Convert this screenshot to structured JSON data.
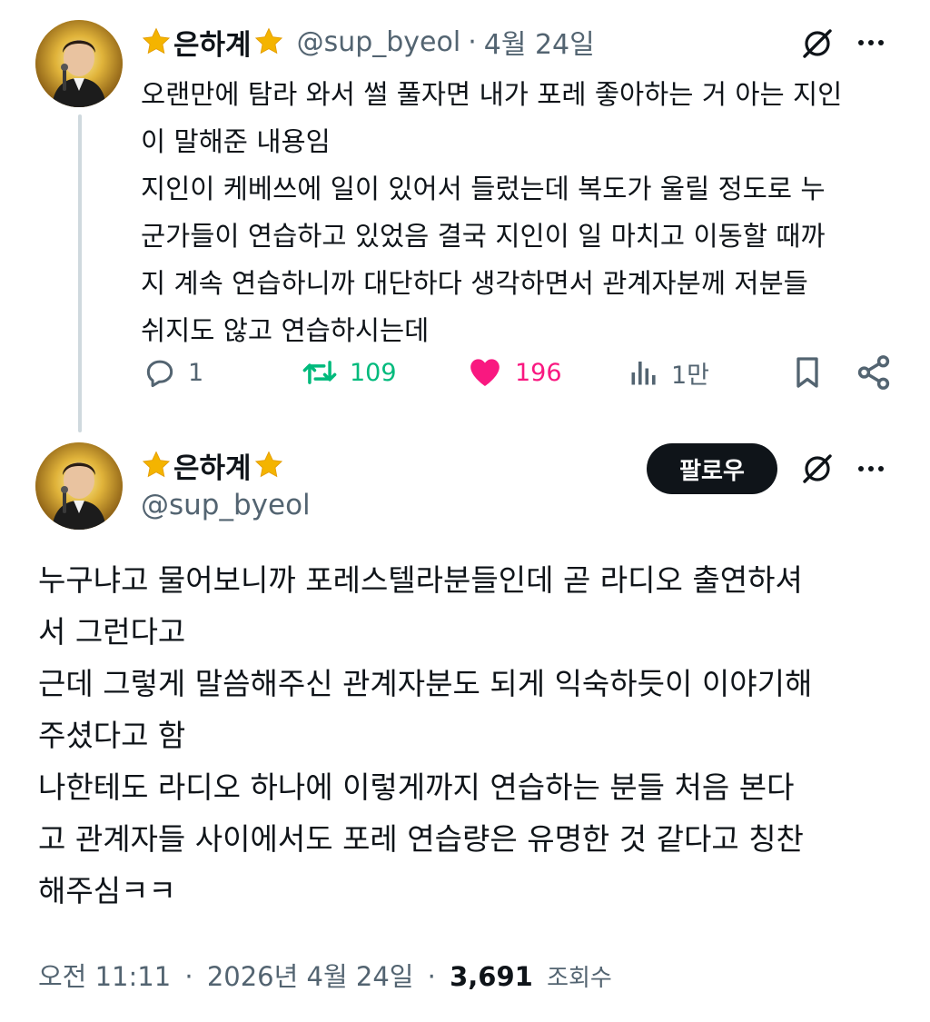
{
  "tweet1": {
    "display_name": "은하계",
    "handle": "@sup_byeol",
    "separator": "·",
    "date": "4월 24일",
    "lines": [
      "오랜만에 탐라 와서 썰 풀자면 내가 포레 좋아하는 거 아는 지인",
      "이 말해준 내용임",
      "지인이 케베쓰에 일이 있어서 들렀는데 복도가 울릴 정도로 누",
      "군가들이 연습하고 있었음 결국 지인이 일 마치고 이동할 때까",
      "지 계속 연습하니까 대단하다 생각하면서 관계자분께 저분들",
      "쉬지도 않고 연습하시는데"
    ],
    "actions": {
      "reply_count": "1",
      "retweet_count": "109",
      "like_count": "196",
      "views_count": "1만"
    }
  },
  "tweet2": {
    "display_name": "은하계",
    "handle": "@sup_byeol",
    "follow_label": "팔로우",
    "lines": [
      "누구냐고 물어보니까 포레스텔라분들인데 곧 라디오 출연하셔",
      "서 그런다고",
      "근데 그렇게 말씀해주신 관계자분도 되게 익숙하듯이 이야기해",
      "주셨다고 함",
      "나한테도 라디오 하나에 이렇게까지 연습하는 분들 처음 본다",
      "고 관계자들 사이에서도 포레 연습량은 유명한 것 같다고 칭찬",
      "해주심ㅋㅋ"
    ],
    "meta": {
      "time": "오전 11:11",
      "separator1": "·",
      "date": "2026년 4월 24일",
      "separator2": "·",
      "views_number": "3,691",
      "views_label": "조회수"
    }
  },
  "colors": {
    "text": "#0f1419",
    "muted": "#536471",
    "retweet": "#00ba7c",
    "like": "#f91880",
    "star": "#f4b400"
  },
  "icons": [
    "star-icon",
    "grok-icon",
    "more-icon",
    "reply-icon",
    "retweet-icon",
    "like-icon",
    "views-icon",
    "bookmark-icon",
    "share-icon"
  ]
}
